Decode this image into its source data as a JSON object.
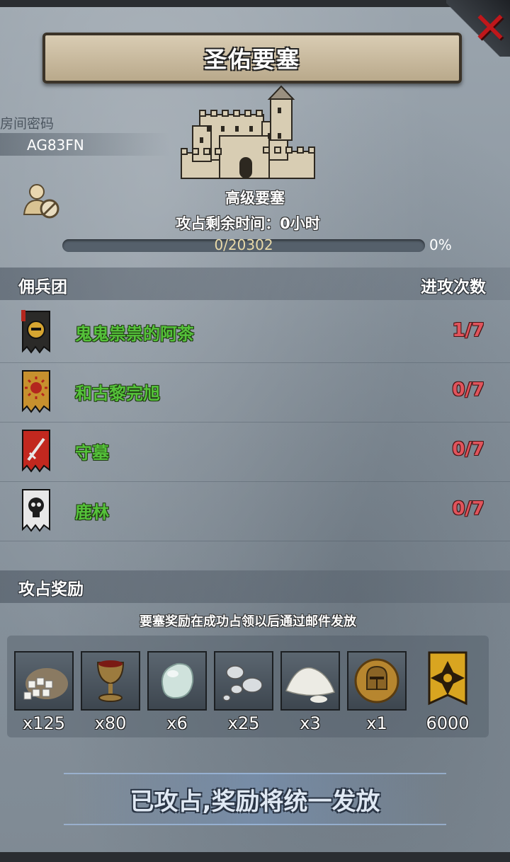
{
  "header": {
    "title": "圣佑要塞",
    "close_icon": "close-x-icon"
  },
  "room": {
    "label": "房间密码",
    "code": "AG83FN",
    "user_icon": "user-blocked-icon"
  },
  "fortress": {
    "icon": "castle-icon",
    "level": "高级要塞",
    "remaining_time_label": "攻占剩余时间：0小时",
    "progress_text": "0/20302",
    "progress_percent": "0%",
    "progress_fraction": 0
  },
  "mercenaries": {
    "title": "佣兵团",
    "count_header": "进攻次数",
    "items": [
      {
        "name": "鬼鬼祟祟的阿茶",
        "count": "1/7",
        "banner_icon": "helmet-banner-icon",
        "banner_color": "#2b2a28",
        "emblem_color": "#d6a531"
      },
      {
        "name": "和古黎完旭",
        "count": "0/7",
        "banner_icon": "sun-banner-icon",
        "banner_color": "#c7902e",
        "emblem_color": "#b3261e"
      },
      {
        "name": "守墓",
        "count": "0/7",
        "banner_icon": "sword-banner-icon",
        "banner_color": "#c2281f",
        "emblem_color": "#e8e8e8"
      },
      {
        "name": "鹿林",
        "count": "0/7",
        "banner_icon": "skull-banner-icon",
        "banner_color": "#e8e8e8",
        "emblem_color": "#1e1e1e"
      }
    ]
  },
  "rewards": {
    "title": "攻占奖励",
    "note": "要塞奖励在成功占领以后通过邮件发放",
    "items": [
      {
        "icon": "sugar-sack-icon",
        "qty": "x125"
      },
      {
        "icon": "goblet-icon",
        "qty": "x80"
      },
      {
        "icon": "moonstone-icon",
        "qty": "x6"
      },
      {
        "icon": "silver-pearls-icon",
        "qty": "x25"
      },
      {
        "icon": "salt-pile-icon",
        "qty": "x3"
      },
      {
        "icon": "knight-helmet-coin-icon",
        "qty": "x1"
      },
      {
        "icon": "honor-banner-icon",
        "qty": "6000"
      }
    ]
  },
  "claim_button": {
    "label": "已攻占,奖励将统一发放"
  }
}
